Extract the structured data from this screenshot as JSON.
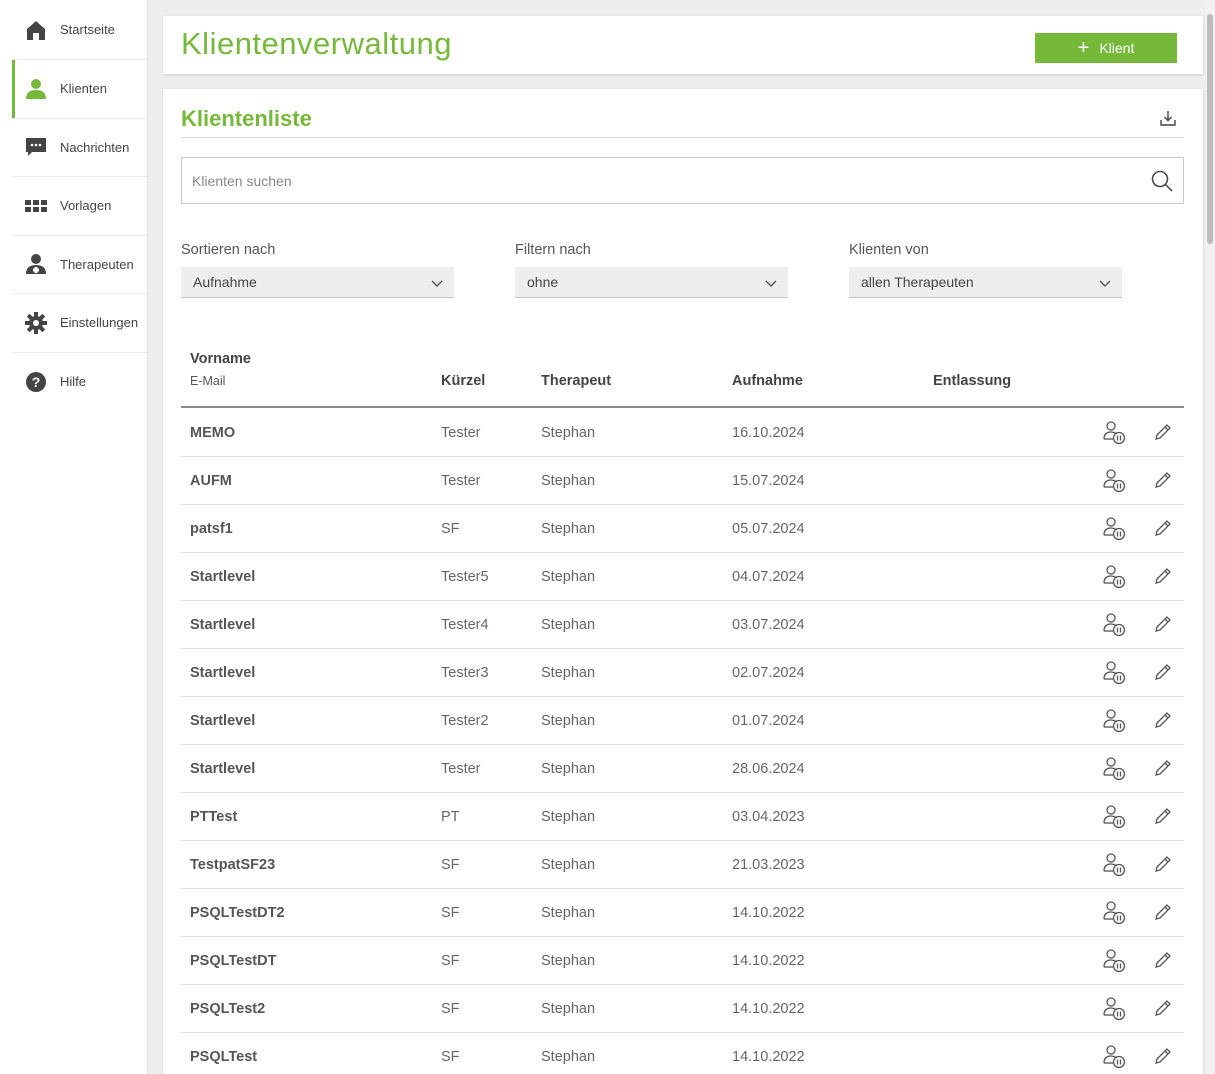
{
  "sidebar": {
    "items": [
      {
        "label": "Startseite",
        "icon": "home-icon"
      },
      {
        "label": "Klienten",
        "icon": "person-icon",
        "active": true
      },
      {
        "label": "Nachrichten",
        "icon": "message-icon"
      },
      {
        "label": "Vorlagen",
        "icon": "grid-icon"
      },
      {
        "label": "Therapeuten",
        "icon": "therapist-icon"
      },
      {
        "label": "Einstellungen",
        "icon": "gear-icon"
      },
      {
        "label": "Hilfe",
        "icon": "help-icon"
      }
    ]
  },
  "header": {
    "title": "Klientenverwaltung",
    "add_button_label": "Klient"
  },
  "list": {
    "title": "Klientenliste",
    "search_placeholder": "Klienten suchen",
    "filters": {
      "sort_label": "Sortieren nach",
      "sort_value": "Aufnahme",
      "filter_label": "Filtern nach",
      "filter_value": "ohne",
      "clients_of_label": "Klienten von",
      "clients_of_value": "allen Therapeuten"
    },
    "columns": {
      "vorname": "Vorname",
      "email": "E-Mail",
      "kuerzel": "Kürzel",
      "therapeut": "Therapeut",
      "aufnahme": "Aufnahme",
      "entlassung": "Entlassung"
    },
    "rows": [
      {
        "name": "MEMO",
        "kuerzel": "Tester",
        "therapeut": "Stephan",
        "aufnahme": "16.10.2024",
        "entlassung": ""
      },
      {
        "name": "AUFM",
        "kuerzel": "Tester",
        "therapeut": "Stephan",
        "aufnahme": "15.07.2024",
        "entlassung": ""
      },
      {
        "name": "patsf1",
        "kuerzel": "SF",
        "therapeut": "Stephan",
        "aufnahme": "05.07.2024",
        "entlassung": ""
      },
      {
        "name": "Startlevel",
        "kuerzel": "Tester5",
        "therapeut": "Stephan",
        "aufnahme": "04.07.2024",
        "entlassung": ""
      },
      {
        "name": "Startlevel",
        "kuerzel": "Tester4",
        "therapeut": "Stephan",
        "aufnahme": "03.07.2024",
        "entlassung": ""
      },
      {
        "name": "Startlevel",
        "kuerzel": "Tester3",
        "therapeut": "Stephan",
        "aufnahme": "02.07.2024",
        "entlassung": ""
      },
      {
        "name": "Startlevel",
        "kuerzel": "Tester2",
        "therapeut": "Stephan",
        "aufnahme": "01.07.2024",
        "entlassung": ""
      },
      {
        "name": "Startlevel",
        "kuerzel": "Tester",
        "therapeut": "Stephan",
        "aufnahme": "28.06.2024",
        "entlassung": ""
      },
      {
        "name": "PTTest",
        "kuerzel": "PT",
        "therapeut": "Stephan",
        "aufnahme": "03.04.2023",
        "entlassung": ""
      },
      {
        "name": "TestpatSF23",
        "kuerzel": "SF",
        "therapeut": "Stephan",
        "aufnahme": "21.03.2023",
        "entlassung": ""
      },
      {
        "name": "PSQLTestDT2",
        "kuerzel": "SF",
        "therapeut": "Stephan",
        "aufnahme": "14.10.2022",
        "entlassung": ""
      },
      {
        "name": "PSQLTestDT",
        "kuerzel": "SF",
        "therapeut": "Stephan",
        "aufnahme": "14.10.2022",
        "entlassung": ""
      },
      {
        "name": "PSQLTest2",
        "kuerzel": "SF",
        "therapeut": "Stephan",
        "aufnahme": "14.10.2022",
        "entlassung": ""
      },
      {
        "name": "PSQLTest",
        "kuerzel": "SF",
        "therapeut": "Stephan",
        "aufnahme": "14.10.2022",
        "entlassung": ""
      }
    ]
  },
  "colors": {
    "accent": "#76b83a",
    "icon_dark": "#444444"
  }
}
